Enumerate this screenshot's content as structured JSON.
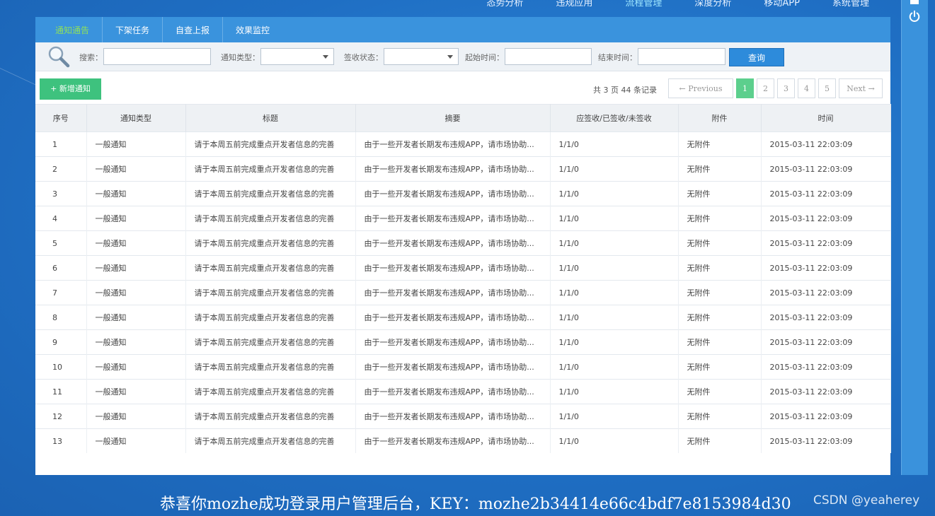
{
  "top_nav": [
    "态势分析",
    "违规应用",
    "流程管理",
    "深度分析",
    "移动APP",
    "系统管理"
  ],
  "top_nav_active_index": 2,
  "tabs": [
    "通知通告",
    "下架任务",
    "自查上报",
    "效果监控"
  ],
  "active_tab_index": 0,
  "filters": {
    "search_label": "搜索：",
    "search_value": "",
    "notice_type_label": "通知类型：",
    "notice_type_value": "",
    "sign_status_label": "签收状态：",
    "sign_status_value": "",
    "start_time_label": "起始时间：",
    "start_time_value": "",
    "end_time_label": "结束时间：",
    "end_time_value": "",
    "query_button": "查询"
  },
  "toolbar": {
    "add_button": "+ 新增通知",
    "page_info": "共 3 页 44 条记录"
  },
  "pagination": {
    "previous": "← Previous",
    "pages": [
      "1",
      "2",
      "3",
      "4",
      "5"
    ],
    "current_page": "1",
    "next": "Next →"
  },
  "table": {
    "headers": [
      "序号",
      "通知类型",
      "标题",
      "摘要",
      "应签收/已签收/未签收",
      "附件",
      "时间"
    ],
    "rows": [
      [
        "1",
        "一般通知",
        "请于本周五前完成重点开发者信息的完善",
        "由于一些开发者长期发布违规APP，请市场协助...",
        "1/1/0",
        "无附件",
        "2015-03-11 22:03:09"
      ],
      [
        "2",
        "一般通知",
        "请于本周五前完成重点开发者信息的完善",
        "由于一些开发者长期发布违规APP，请市场协助...",
        "1/1/0",
        "无附件",
        "2015-03-11 22:03:09"
      ],
      [
        "3",
        "一般通知",
        "请于本周五前完成重点开发者信息的完善",
        "由于一些开发者长期发布违规APP，请市场协助...",
        "1/1/0",
        "无附件",
        "2015-03-11 22:03:09"
      ],
      [
        "4",
        "一般通知",
        "请于本周五前完成重点开发者信息的完善",
        "由于一些开发者长期发布违规APP，请市场协助...",
        "1/1/0",
        "无附件",
        "2015-03-11 22:03:09"
      ],
      [
        "5",
        "一般通知",
        "请于本周五前完成重点开发者信息的完善",
        "由于一些开发者长期发布违规APP，请市场协助...",
        "1/1/0",
        "无附件",
        "2015-03-11 22:03:09"
      ],
      [
        "6",
        "一般通知",
        "请于本周五前完成重点开发者信息的完善",
        "由于一些开发者长期发布违规APP，请市场协助...",
        "1/1/0",
        "无附件",
        "2015-03-11 22:03:09"
      ],
      [
        "7",
        "一般通知",
        "请于本周五前完成重点开发者信息的完善",
        "由于一些开发者长期发布违规APP，请市场协助...",
        "1/1/0",
        "无附件",
        "2015-03-11 22:03:09"
      ],
      [
        "8",
        "一般通知",
        "请于本周五前完成重点开发者信息的完善",
        "由于一些开发者长期发布违规APP，请市场协助...",
        "1/1/0",
        "无附件",
        "2015-03-11 22:03:09"
      ],
      [
        "9",
        "一般通知",
        "请于本周五前完成重点开发者信息的完善",
        "由于一些开发者长期发布违规APP，请市场协助...",
        "1/1/0",
        "无附件",
        "2015-03-11 22:03:09"
      ],
      [
        "10",
        "一般通知",
        "请于本周五前完成重点开发者信息的完善",
        "由于一些开发者长期发布违规APP，请市场协助...",
        "1/1/0",
        "无附件",
        "2015-03-11 22:03:09"
      ],
      [
        "11",
        "一般通知",
        "请于本周五前完成重点开发者信息的完善",
        "由于一些开发者长期发布违规APP，请市场协助...",
        "1/1/0",
        "无附件",
        "2015-03-11 22:03:09"
      ],
      [
        "12",
        "一般通知",
        "请于本周五前完成重点开发者信息的完善",
        "由于一些开发者长期发布违规APP，请市场协助...",
        "1/1/0",
        "无附件",
        "2015-03-11 22:03:09"
      ],
      [
        "13",
        "一般通知",
        "请于本周五前完成重点开发者信息的完善",
        "由于一些开发者长期发布违规APP，请市场协助...",
        "1/1/0",
        "无附件",
        "2015-03-11 22:03:09"
      ]
    ]
  },
  "caption": "恭喜你mozhe成功登录用户管理后台，KEY：mozhe2b34414e66c4bdf7e8153984d30",
  "watermark": "CSDN @yeaherey",
  "colors": {
    "background": "#1f6fc4",
    "tab_bar": "#3a93dd",
    "active_tab_text": "#8fe05a",
    "add_button": "#3ec27e",
    "active_page": "#5ccf8d",
    "query_button": "#2d8bdb"
  }
}
